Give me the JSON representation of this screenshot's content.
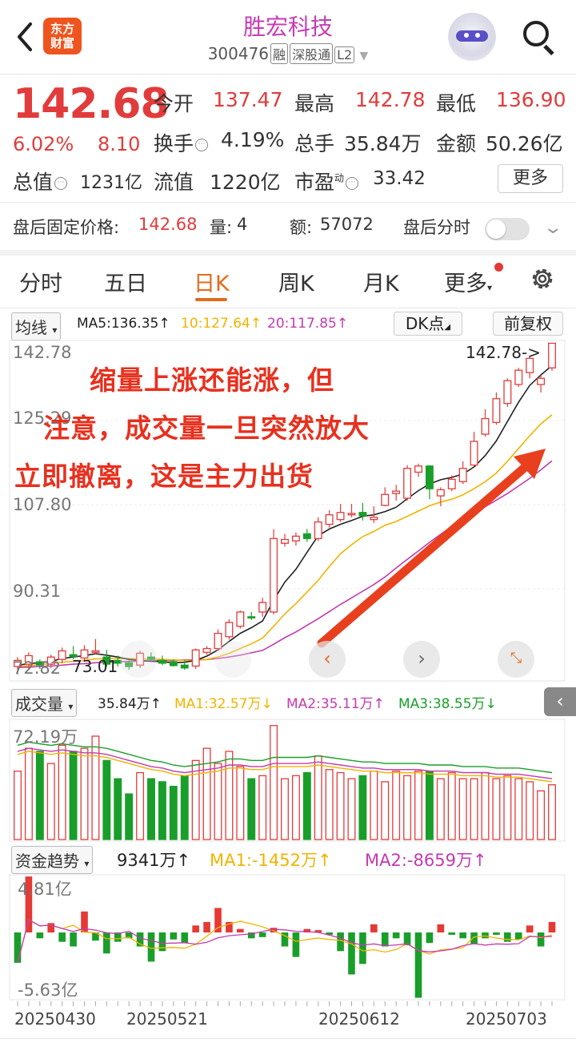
{
  "header": {
    "back_icon": "chevron-left-icon",
    "logo_text_1": "东方",
    "logo_text_2": "财富",
    "stock_name": "胜宏科技",
    "stock_code": "300476",
    "tags": [
      "融",
      "深股通",
      "L2"
    ]
  },
  "quote": {
    "price": "142.68",
    "change_pct": "6.02%",
    "change_amt": "8.10",
    "open_label": "今开",
    "open": "137.47",
    "high_label": "最高",
    "high": "142.78",
    "low_label": "最低",
    "low": "136.90",
    "turnover_label": "换手",
    "turnover": "4.19%",
    "volume_label": "总手",
    "volume": "35.84万",
    "amount_label": "金额",
    "amount": "50.26亿",
    "mktcap_label": "总值",
    "mktcap": "1231亿",
    "float_label": "流值",
    "float_cap": "1220亿",
    "pe_label": "市盈",
    "pe_sup": "动",
    "pe": "33.42",
    "more_label": "更多"
  },
  "afterhours": {
    "price_label": "盘后固定价格:",
    "price": "142.68",
    "vol_label": "量:",
    "vol": "4",
    "amt_label": "额:",
    "amt": "57072",
    "timeshare_label": "盘后分时"
  },
  "tabs": [
    "分时",
    "五日",
    "日K",
    "周K",
    "月K",
    "更多"
  ],
  "kline": {
    "selector": "均线",
    "ma5": "MA5:136.35↑",
    "ma10": "10:127.64↑",
    "ma20": "20:117.85↑",
    "dk_label": "DK点",
    "adjust_label": "前复权",
    "y_labels": [
      "142.78",
      "125.29",
      "107.80",
      "90.31",
      "72.82"
    ],
    "max_marker": "142.78->",
    "min_marker": "73.01",
    "annotation_lines": [
      "缩量上涨还能涨，但",
      "注意，成交量一旦突然放大",
      "立即撤离，这是主力出货"
    ],
    "colors": {
      "up": "#e23b3b",
      "down": "#1a9e2a",
      "ma5": "#222222",
      "ma10": "#f0b400",
      "ma20": "#c43ab0",
      "arrow": "#e8401e"
    }
  },
  "volume_panel": {
    "selector": "成交量",
    "value": "35.84万↑",
    "ma1": "MA1:32.57万↓",
    "ma2": "MA2:35.11万↑",
    "ma3": "MA3:38.55万↓",
    "y_top": "72.19万"
  },
  "fund_panel": {
    "selector": "资金趋势",
    "value": "9341万↑",
    "ma1": "MA1:-1452万↑",
    "ma2": "MA2:-8659万↑",
    "y_top": "4.81亿",
    "y_bottom": "-5.63亿"
  },
  "dates": [
    "20250430",
    "20250521",
    "20250612",
    "20250703"
  ],
  "chart_data": {
    "type": "candlestick",
    "candles": [
      {
        "o": 74.5,
        "h": 76.5,
        "l": 72.8,
        "c": 75.8
      },
      {
        "o": 75.0,
        "h": 77.5,
        "l": 74.0,
        "c": 76.8
      },
      {
        "o": 75.5,
        "h": 76.0,
        "l": 74.0,
        "c": 74.8
      },
      {
        "o": 75.0,
        "h": 77.0,
        "l": 74.2,
        "c": 76.5
      },
      {
        "o": 76.0,
        "h": 78.5,
        "l": 75.2,
        "c": 77.8
      },
      {
        "o": 77.0,
        "h": 78.8,
        "l": 76.0,
        "c": 76.6
      },
      {
        "o": 76.3,
        "h": 79.0,
        "l": 75.5,
        "c": 78.0
      },
      {
        "o": 77.5,
        "h": 80.3,
        "l": 77.0,
        "c": 77.8
      },
      {
        "o": 76.5,
        "h": 78.0,
        "l": 74.5,
        "c": 75.0
      },
      {
        "o": 75.8,
        "h": 76.8,
        "l": 74.5,
        "c": 75.2
      },
      {
        "o": 75.3,
        "h": 75.8,
        "l": 73.8,
        "c": 74.5
      },
      {
        "o": 74.8,
        "h": 77.8,
        "l": 74.2,
        "c": 77.3
      },
      {
        "o": 76.5,
        "h": 77.5,
        "l": 75.8,
        "c": 76.0
      },
      {
        "o": 75.8,
        "h": 76.8,
        "l": 74.8,
        "c": 75.2
      },
      {
        "o": 75.5,
        "h": 76.0,
        "l": 74.5,
        "c": 74.7
      },
      {
        "o": 74.8,
        "h": 75.8,
        "l": 73.8,
        "c": 74.2
      },
      {
        "o": 74.6,
        "h": 78.3,
        "l": 74.0,
        "c": 78.0
      },
      {
        "o": 77.5,
        "h": 78.8,
        "l": 77.0,
        "c": 78.3
      },
      {
        "o": 78.3,
        "h": 82.3,
        "l": 78.0,
        "c": 81.5
      },
      {
        "o": 80.8,
        "h": 84.5,
        "l": 80.2,
        "c": 83.8
      },
      {
        "o": 83.0,
        "h": 86.3,
        "l": 82.5,
        "c": 86.0
      },
      {
        "o": 85.0,
        "h": 86.0,
        "l": 84.3,
        "c": 84.8
      },
      {
        "o": 86.0,
        "h": 89.0,
        "l": 85.0,
        "c": 88.0
      },
      {
        "o": 86.0,
        "h": 103.5,
        "l": 85.5,
        "c": 101.5
      },
      {
        "o": 100.5,
        "h": 102.5,
        "l": 99.8,
        "c": 101.3
      },
      {
        "o": 101.0,
        "h": 102.8,
        "l": 100.0,
        "c": 102.0
      },
      {
        "o": 102.5,
        "h": 103.5,
        "l": 100.8,
        "c": 101.5
      },
      {
        "o": 101.5,
        "h": 106.0,
        "l": 101.0,
        "c": 105.0
      },
      {
        "o": 104.5,
        "h": 107.5,
        "l": 103.8,
        "c": 106.5
      },
      {
        "o": 105.5,
        "h": 108.8,
        "l": 105.0,
        "c": 107.0
      },
      {
        "o": 106.5,
        "h": 108.8,
        "l": 106.0,
        "c": 106.8
      },
      {
        "o": 107.0,
        "h": 109.0,
        "l": 105.3,
        "c": 106.3
      },
      {
        "o": 105.5,
        "h": 108.3,
        "l": 104.8,
        "c": 106.0
      },
      {
        "o": 108.5,
        "h": 112.3,
        "l": 108.3,
        "c": 110.8
      },
      {
        "o": 111.0,
        "h": 112.8,
        "l": 109.5,
        "c": 111.5
      },
      {
        "o": 110.0,
        "h": 117.0,
        "l": 109.5,
        "c": 116.3
      },
      {
        "o": 115.5,
        "h": 117.3,
        "l": 114.5,
        "c": 116.8
      },
      {
        "o": 116.8,
        "h": 117.0,
        "l": 109.8,
        "c": 112.0
      },
      {
        "o": 110.5,
        "h": 112.3,
        "l": 108.3,
        "c": 111.8
      },
      {
        "o": 112.0,
        "h": 114.8,
        "l": 111.5,
        "c": 114.0
      },
      {
        "o": 113.5,
        "h": 117.8,
        "l": 113.0,
        "c": 116.3
      },
      {
        "o": 117.0,
        "h": 124.0,
        "l": 116.8,
        "c": 122.0
      },
      {
        "o": 123.5,
        "h": 128.8,
        "l": 123.0,
        "c": 126.8
      },
      {
        "o": 126.0,
        "h": 132.3,
        "l": 125.5,
        "c": 131.0
      },
      {
        "o": 130.0,
        "h": 135.3,
        "l": 129.3,
        "c": 134.8
      },
      {
        "o": 134.0,
        "h": 137.5,
        "l": 133.5,
        "c": 137.0
      },
      {
        "o": 136.5,
        "h": 140.0,
        "l": 135.3,
        "c": 139.5
      },
      {
        "o": 134.0,
        "h": 136.0,
        "l": 132.3,
        "c": 135.3
      },
      {
        "o": 137.5,
        "h": 142.8,
        "l": 136.9,
        "c": 142.7
      }
    ],
    "ma5": [
      74.8,
      75.1,
      75.3,
      75.6,
      76.2,
      76.5,
      76.8,
      77.2,
      76.9,
      76.5,
      76.0,
      75.8,
      75.6,
      75.5,
      75.3,
      75.4,
      75.8,
      76.7,
      78.0,
      79.8,
      81.5,
      82.7,
      84.1,
      88.5,
      92.3,
      95.0,
      98.6,
      102.1,
      103.5,
      104.5,
      105.3,
      106.2,
      106.5,
      107.2,
      108.1,
      109.9,
      111.6,
      113.0,
      113.9,
      114.4,
      115.1,
      116.6,
      119.0,
      122.1,
      126.2,
      130.3,
      133.8,
      136.0,
      138.0
    ],
    "ma10": [
      74.5,
      74.7,
      74.9,
      75.1,
      75.4,
      75.6,
      75.8,
      76.1,
      76.2,
      76.2,
      76.2,
      76.1,
      76.1,
      76.0,
      75.9,
      75.8,
      75.8,
      76.0,
      76.5,
      77.3,
      78.3,
      79.3,
      80.5,
      83.0,
      85.6,
      87.8,
      90.2,
      92.7,
      95.6,
      98.3,
      100.2,
      101.9,
      103.0,
      104.3,
      105.1,
      106.2,
      107.3,
      108.4,
      109.2,
      109.8,
      110.7,
      112.0,
      113.5,
      115.3,
      117.8,
      120.5,
      123.2,
      125.7,
      127.6
    ],
    "ma20": [
      74.3,
      74.4,
      74.5,
      74.6,
      74.8,
      75.0,
      75.1,
      75.3,
      75.4,
      75.5,
      75.6,
      75.6,
      75.7,
      75.8,
      75.8,
      75.9,
      75.9,
      76.0,
      76.2,
      76.5,
      76.9,
      77.4,
      77.9,
      79.2,
      80.6,
      81.8,
      83.2,
      84.6,
      86.1,
      87.6,
      89.0,
      90.4,
      91.8,
      93.4,
      95.3,
      97.1,
      98.9,
      100.7,
      102.4,
      104.1,
      105.5,
      106.9,
      108.2,
      109.6,
      111.0,
      112.6,
      114.2,
      116.0,
      117.9
    ],
    "volume_wan": [
      45,
      60,
      58,
      50,
      62,
      58,
      60,
      68,
      52,
      40,
      30,
      44,
      40,
      38,
      35,
      42,
      52,
      60,
      50,
      58,
      48,
      40,
      42,
      75,
      40,
      42,
      44,
      55,
      46,
      44,
      40,
      42,
      45,
      38,
      45,
      42,
      45,
      45,
      40,
      44,
      40,
      40,
      44,
      40,
      42,
      40,
      38,
      32,
      36
    ],
    "vol_ma": [
      56,
      58,
      57,
      56,
      57,
      56,
      55,
      55,
      54,
      52,
      50,
      48,
      46,
      45,
      43,
      42,
      43,
      44,
      45,
      47,
      47,
      46,
      46,
      48,
      48,
      48,
      48,
      49,
      48,
      47,
      46,
      45,
      45,
      44,
      44,
      44,
      44,
      43,
      43,
      43,
      42,
      42,
      42,
      41,
      41,
      41,
      40,
      39,
      38
    ],
    "fund_yi": [
      -2.6,
      4.8,
      -0.5,
      0.8,
      -0.8,
      -1.2,
      1.8,
      -0.7,
      -1.8,
      -0.8,
      -0.5,
      -1.2,
      -2.5,
      -1.6,
      -0.6,
      -0.9,
      0.6,
      0.9,
      2.1,
      0.9,
      0.3,
      -0.5,
      -0.4,
      0.4,
      -1.2,
      -2.1,
      0.3,
      0.2,
      -0.2,
      -1.6,
      -3.6,
      -2.7,
      0.7,
      -1.2,
      -0.5,
      -1.1,
      -5.6,
      -0.9,
      0.7,
      -0.2,
      -0.5,
      -1.0,
      -0.5,
      -0.2,
      -0.8,
      -0.6,
      0.6,
      -1.2,
      0.9
    ],
    "ylim": [
      72.82,
      142.78
    ]
  }
}
